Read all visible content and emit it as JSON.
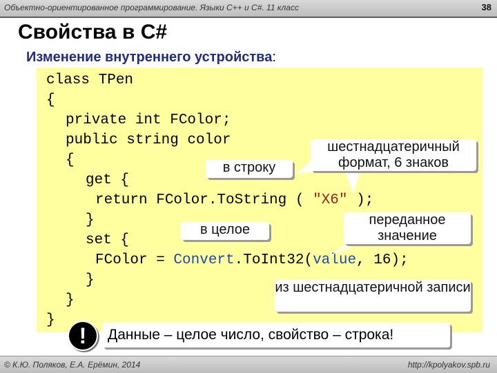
{
  "header": {
    "course": "Объектно-ориентированное программирование. Языки C++ и C#. 11 класс",
    "page_number": "38"
  },
  "slide": {
    "title": "Свойства в C#",
    "subtitle": "Изменение внутреннего устройства",
    "subtitle_colon": ":"
  },
  "code": {
    "l1": "class TPen",
    "l2": "{",
    "l3": "private int FColor;",
    "l4": "public string color",
    "l5": "{",
    "l6": "get {",
    "l7a": "return FColor.ToString ( ",
    "l7b": "\"X6\"",
    "l7c": " );",
    "l8": "}",
    "l9": "set {",
    "l10a": "FColor = ",
    "l10b": "Convert",
    "l10c": ".ToInt32(",
    "l10d": "value",
    "l10e": ", 16);",
    "l11": "}",
    "l12": "}",
    "l13": "}"
  },
  "callouts": {
    "hex_format": "шестнадцатеричный формат, 6 знаков",
    "to_string": "в строку",
    "to_int": "в целое",
    "passed_value": "переданное значение",
    "from_hex": "из шестнадцатеричной записи"
  },
  "note": {
    "icon": "exclamation-icon",
    "bang": "!",
    "text": "Данные – целое число, свойство – строка!"
  },
  "footer": {
    "authors": "© К.Ю. Поляков, Е.А. Ерёмин, 2014",
    "site": "http://kpolyakov.spb.ru"
  }
}
